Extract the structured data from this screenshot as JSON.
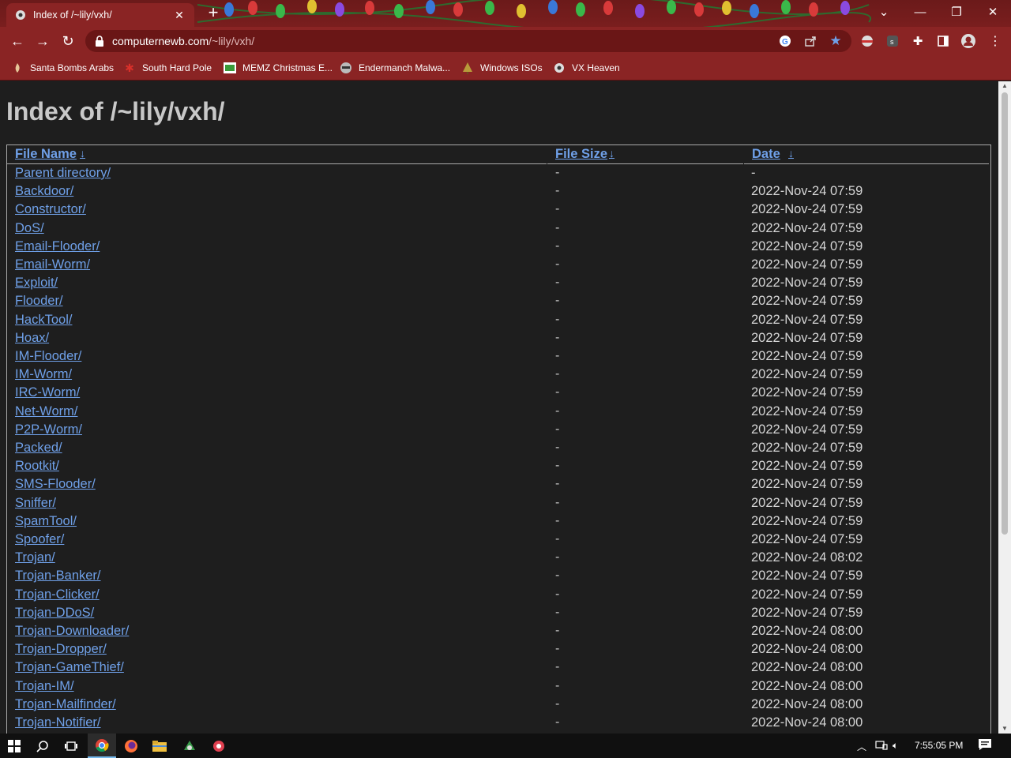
{
  "browser": {
    "tab_title": "Index of /~lily/vxh/",
    "url_host": "computernewb.com",
    "url_path": "/~lily/vxh/",
    "bookmarks": [
      {
        "label": "Santa Bombs Arabs",
        "icon": "flame-icon"
      },
      {
        "label": "South Hard Pole",
        "icon": "red-star-icon"
      },
      {
        "label": "MEMZ Christmas E...",
        "icon": "screen-icon"
      },
      {
        "label": "Endermanch Malwa...",
        "icon": "raccoon-icon"
      },
      {
        "label": "Windows ISOs",
        "icon": "tree-icon"
      },
      {
        "label": "VX Heaven",
        "icon": "biohazard-icon"
      }
    ]
  },
  "page": {
    "title": "Index of /~lily/vxh/",
    "columns": {
      "name": "File Name",
      "size": "File Size",
      "date": "Date",
      "sort_glyph": "↓"
    },
    "rows": [
      {
        "name": "Parent directory/",
        "size": "-",
        "date": "-"
      },
      {
        "name": "Backdoor/",
        "size": "-",
        "date": "2022-Nov-24 07:59"
      },
      {
        "name": "Constructor/",
        "size": "-",
        "date": "2022-Nov-24 07:59"
      },
      {
        "name": "DoS/",
        "size": "-",
        "date": "2022-Nov-24 07:59"
      },
      {
        "name": "Email-Flooder/",
        "size": "-",
        "date": "2022-Nov-24 07:59"
      },
      {
        "name": "Email-Worm/",
        "size": "-",
        "date": "2022-Nov-24 07:59"
      },
      {
        "name": "Exploit/",
        "size": "-",
        "date": "2022-Nov-24 07:59"
      },
      {
        "name": "Flooder/",
        "size": "-",
        "date": "2022-Nov-24 07:59"
      },
      {
        "name": "HackTool/",
        "size": "-",
        "date": "2022-Nov-24 07:59"
      },
      {
        "name": "Hoax/",
        "size": "-",
        "date": "2022-Nov-24 07:59"
      },
      {
        "name": "IM-Flooder/",
        "size": "-",
        "date": "2022-Nov-24 07:59"
      },
      {
        "name": "IM-Worm/",
        "size": "-",
        "date": "2022-Nov-24 07:59"
      },
      {
        "name": "IRC-Worm/",
        "size": "-",
        "date": "2022-Nov-24 07:59"
      },
      {
        "name": "Net-Worm/",
        "size": "-",
        "date": "2022-Nov-24 07:59"
      },
      {
        "name": "P2P-Worm/",
        "size": "-",
        "date": "2022-Nov-24 07:59"
      },
      {
        "name": "Packed/",
        "size": "-",
        "date": "2022-Nov-24 07:59"
      },
      {
        "name": "Rootkit/",
        "size": "-",
        "date": "2022-Nov-24 07:59"
      },
      {
        "name": "SMS-Flooder/",
        "size": "-",
        "date": "2022-Nov-24 07:59"
      },
      {
        "name": "Sniffer/",
        "size": "-",
        "date": "2022-Nov-24 07:59"
      },
      {
        "name": "SpamTool/",
        "size": "-",
        "date": "2022-Nov-24 07:59"
      },
      {
        "name": "Spoofer/",
        "size": "-",
        "date": "2022-Nov-24 07:59"
      },
      {
        "name": "Trojan/",
        "size": "-",
        "date": "2022-Nov-24 08:02"
      },
      {
        "name": "Trojan-Banker/",
        "size": "-",
        "date": "2022-Nov-24 07:59"
      },
      {
        "name": "Trojan-Clicker/",
        "size": "-",
        "date": "2022-Nov-24 07:59"
      },
      {
        "name": "Trojan-DDoS/",
        "size": "-",
        "date": "2022-Nov-24 07:59"
      },
      {
        "name": "Trojan-Downloader/",
        "size": "-",
        "date": "2022-Nov-24 08:00"
      },
      {
        "name": "Trojan-Dropper/",
        "size": "-",
        "date": "2022-Nov-24 08:00"
      },
      {
        "name": "Trojan-GameThief/",
        "size": "-",
        "date": "2022-Nov-24 08:00"
      },
      {
        "name": "Trojan-IM/",
        "size": "-",
        "date": "2022-Nov-24 08:00"
      },
      {
        "name": "Trojan-Mailfinder/",
        "size": "-",
        "date": "2022-Nov-24 08:00"
      },
      {
        "name": "Trojan-Notifier/",
        "size": "-",
        "date": "2022-Nov-24 08:00"
      }
    ]
  },
  "taskbar": {
    "clock": "7:55:05 PM",
    "apps": [
      "windows-start-icon",
      "search-icon",
      "task-view-icon",
      "chrome-icon",
      "firefox-icon",
      "file-explorer-icon",
      "app-icon",
      "app-icon"
    ]
  },
  "colors": {
    "chrome_bg": "#8a2424",
    "page_bg": "#1e1e1e",
    "link": "#6fa0e8",
    "text": "#d6d6d6"
  }
}
